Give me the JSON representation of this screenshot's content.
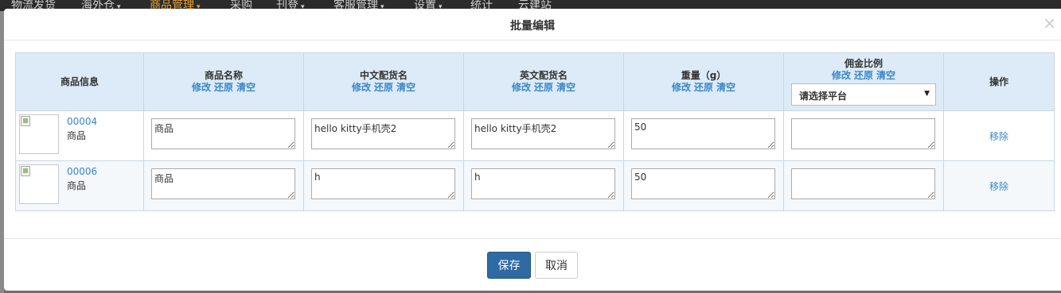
{
  "background_nav": {
    "items": [
      {
        "label": "物流发货",
        "caret": false
      },
      {
        "label": "海外仓",
        "caret": true
      },
      {
        "label": "商品管理",
        "caret": true,
        "active": true
      },
      {
        "label": "采购",
        "caret": false
      },
      {
        "label": "刊登",
        "caret": true
      },
      {
        "label": "客服管理",
        "caret": true
      },
      {
        "label": "设置",
        "caret": true
      },
      {
        "label": "统计",
        "caret": false
      },
      {
        "label": "云建站",
        "caret": false
      }
    ]
  },
  "modal": {
    "title": "批量编辑",
    "close_symbol": "×"
  },
  "table": {
    "headers": {
      "product_info": "商品信息",
      "product_name": "商品名称",
      "cn_declare_name": "中文配货名",
      "en_declare_name": "英文配货名",
      "weight": "重量（g）",
      "commission": "佣金比例",
      "operation": "操作"
    },
    "header_actions": {
      "modify": "修改",
      "restore": "还原",
      "clear": "清空"
    },
    "platform_select": {
      "value": "请选择平台",
      "caret": "▼"
    },
    "rows": [
      {
        "code": "00004",
        "name": "商品",
        "product_name": "商品",
        "cn_name": "hello kitty手机壳2",
        "en_name": "hello kitty手机壳2",
        "weight": "50",
        "commission": "",
        "remove": "移除"
      },
      {
        "code": "00006",
        "name": "商品",
        "product_name": "商品",
        "cn_name": "h",
        "en_name": "h",
        "weight": "50",
        "commission": "",
        "remove": "移除"
      }
    ]
  },
  "footer": {
    "save_label": "保存",
    "cancel_label": "取消"
  },
  "colors": {
    "header_bg": "#dcebf7",
    "link": "#3a86c8",
    "primary_button": "#2f6aa3",
    "active_nav": "#e8a33a"
  }
}
